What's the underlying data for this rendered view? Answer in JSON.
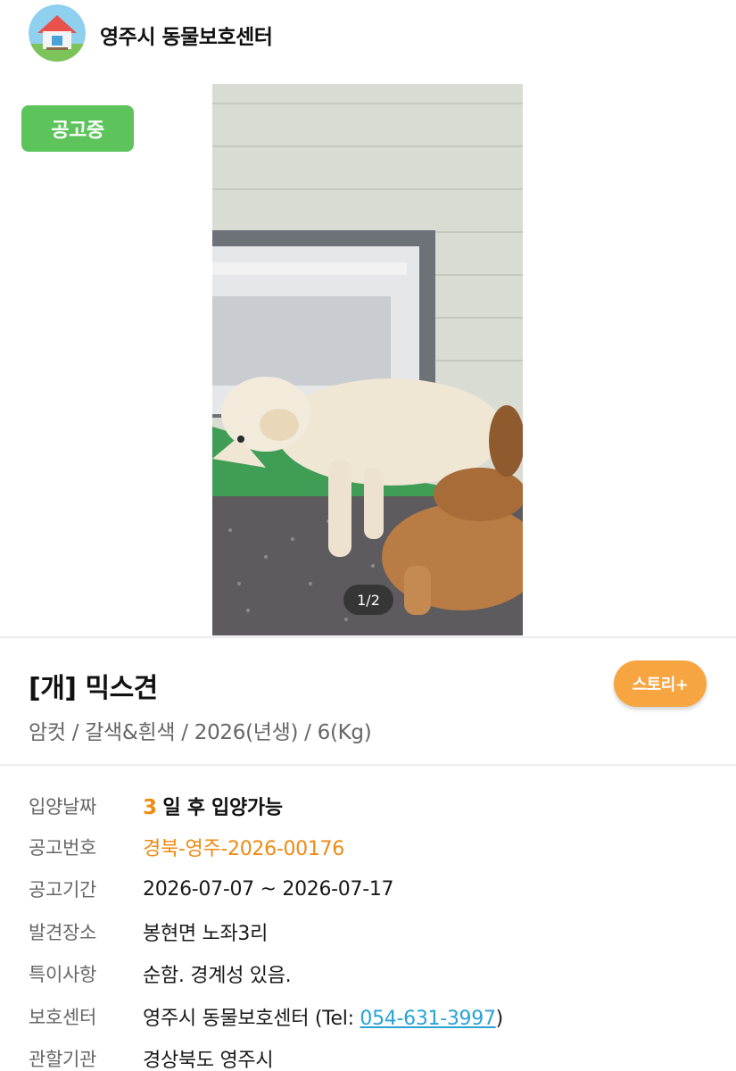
{
  "header": {
    "shelter_name": "영주시 동물보호센터",
    "avatar_icon": "house-icon"
  },
  "status": {
    "label": "공고중",
    "color": "#5cc45a"
  },
  "photo": {
    "counter": "1/2",
    "current": 1,
    "total": 2
  },
  "animal": {
    "title": "[개] 믹스견",
    "summary": "암컷 / 갈색&흰색 / 2026(년생) / 6(Kg)"
  },
  "story_button": {
    "label": "스토리+",
    "color": "#f7a541"
  },
  "details": {
    "adoption": {
      "label": "입양날짜",
      "days": "3",
      "text": "일 후 입양가능"
    },
    "notice_no": {
      "label": "공고번호",
      "value": "경북-영주-2026-00176"
    },
    "period": {
      "label": "공고기간",
      "value": "2026-07-07 ~ 2026-07-17"
    },
    "found_place": {
      "label": "발견장소",
      "value": "봉현면 노좌3리"
    },
    "special": {
      "label": "특이사항",
      "value": "순함. 경계성 있음."
    },
    "center": {
      "label": "보호센터",
      "name_prefix": "영주시 동물보호센터 (Tel: ",
      "tel": "054-631-3997",
      "suffix": ")"
    },
    "authority": {
      "label": "관할기관",
      "value": "경상북도 영주시"
    }
  },
  "colors": {
    "accent_orange": "#ef8a12",
    "link_blue": "#2aa2d6"
  }
}
